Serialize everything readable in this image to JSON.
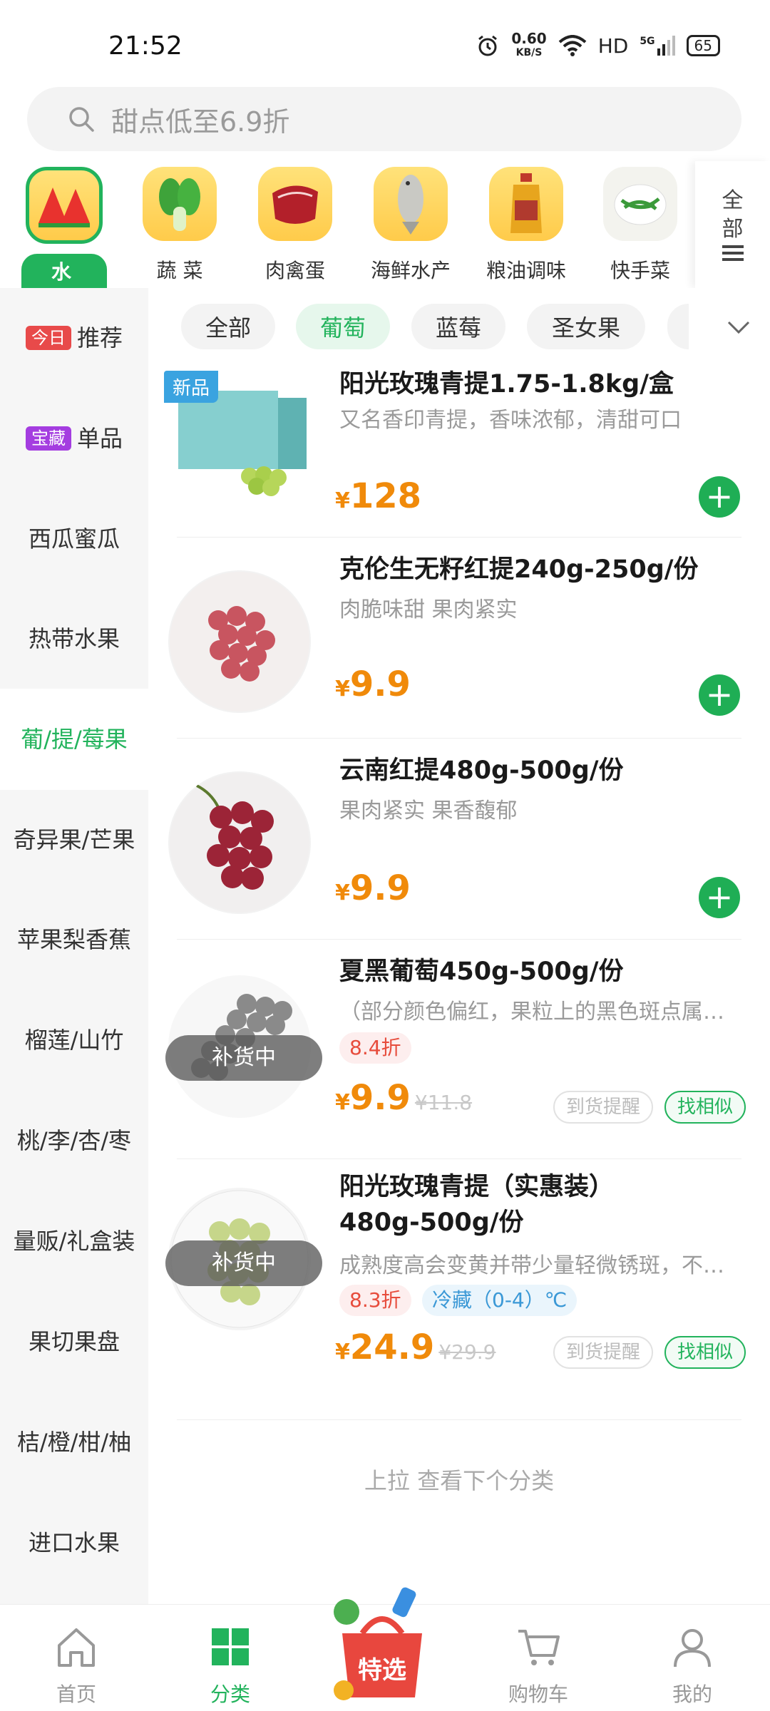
{
  "status_bar": {
    "time": "21:52",
    "speed_value": "0.60",
    "speed_unit": "KB/S",
    "hd": "HD",
    "network": "5G",
    "battery": "65"
  },
  "search": {
    "placeholder": "甜点低至6.9折"
  },
  "categories": [
    {
      "label": "水 果",
      "icon": "watermelon"
    },
    {
      "label": "蔬 菜",
      "icon": "bok-choy"
    },
    {
      "label": "肉禽蛋",
      "icon": "meat"
    },
    {
      "label": "海鲜水产",
      "icon": "fish"
    },
    {
      "label": "粮油调味",
      "icon": "oil-bottle"
    },
    {
      "label": "快手菜",
      "icon": "dish"
    }
  ],
  "all_categories": {
    "line1": "全",
    "line2": "部"
  },
  "sidebar": [
    {
      "tag": "今日",
      "tag_color": "#e84a4a",
      "label": "推荐"
    },
    {
      "tag": "宝藏",
      "tag_color": "#a43de0",
      "label": "单品"
    },
    {
      "label": "西瓜蜜瓜"
    },
    {
      "label": "热带水果"
    },
    {
      "label": "葡/提/莓果"
    },
    {
      "label": "奇异果/芒果"
    },
    {
      "label": "苹果梨香蕉"
    },
    {
      "label": "榴莲/山竹"
    },
    {
      "label": "桃/李/杏/枣"
    },
    {
      "label": "量贩/礼盒装"
    },
    {
      "label": "果切果盘"
    },
    {
      "label": "桔/橙/柑/柚"
    },
    {
      "label": "进口水果"
    }
  ],
  "filters": [
    "全部",
    "葡萄",
    "蓝莓",
    "圣女果"
  ],
  "products": [
    {
      "name": "阳光玫瑰青提1.75-1.8kg/盒",
      "desc": "又名香印青提，香味浓郁，清甜可口",
      "currency": "¥",
      "price": "128",
      "tag": "新品"
    },
    {
      "name": "克伦生无籽红提240g-250g/份",
      "desc": "肉脆味甜 果肉紧实",
      "currency": "¥",
      "price": "9.9"
    },
    {
      "name": "云南红提480g-500g/份",
      "desc": "果肉紧实 果香馥郁",
      "currency": "¥",
      "price": "9.9"
    },
    {
      "name": "夏黑葡萄450g-500g/份",
      "desc": "（部分颜色偏红，果粒上的黑色斑点属正常",
      "currency": "¥",
      "price": "9.9",
      "old_price": "¥11.8",
      "discount": "8.4折",
      "overlay": "补货中",
      "notify": "到货提醒",
      "similar": "找相似"
    },
    {
      "name_line1": "阳光玫瑰青提（实惠装）",
      "name_line2": "480g-500g/份",
      "desc": "成熟度高会变黄并带少量轻微锈斑，不影响",
      "currency": "¥",
      "price": "24.9",
      "old_price": "¥29.9",
      "discount": "8.3折",
      "storage": "冷藏（0-4）℃",
      "overlay": "补货中",
      "notify": "到货提醒",
      "similar": "找相似"
    }
  ],
  "pull_hint": "上拉 查看下个分类",
  "bottom_nav": {
    "home": "首页",
    "category": "分类",
    "special": "特选",
    "cart": "购物车",
    "mine": "我的"
  },
  "colors": {
    "accent": "#22b35c",
    "price": "#f08a0a"
  }
}
